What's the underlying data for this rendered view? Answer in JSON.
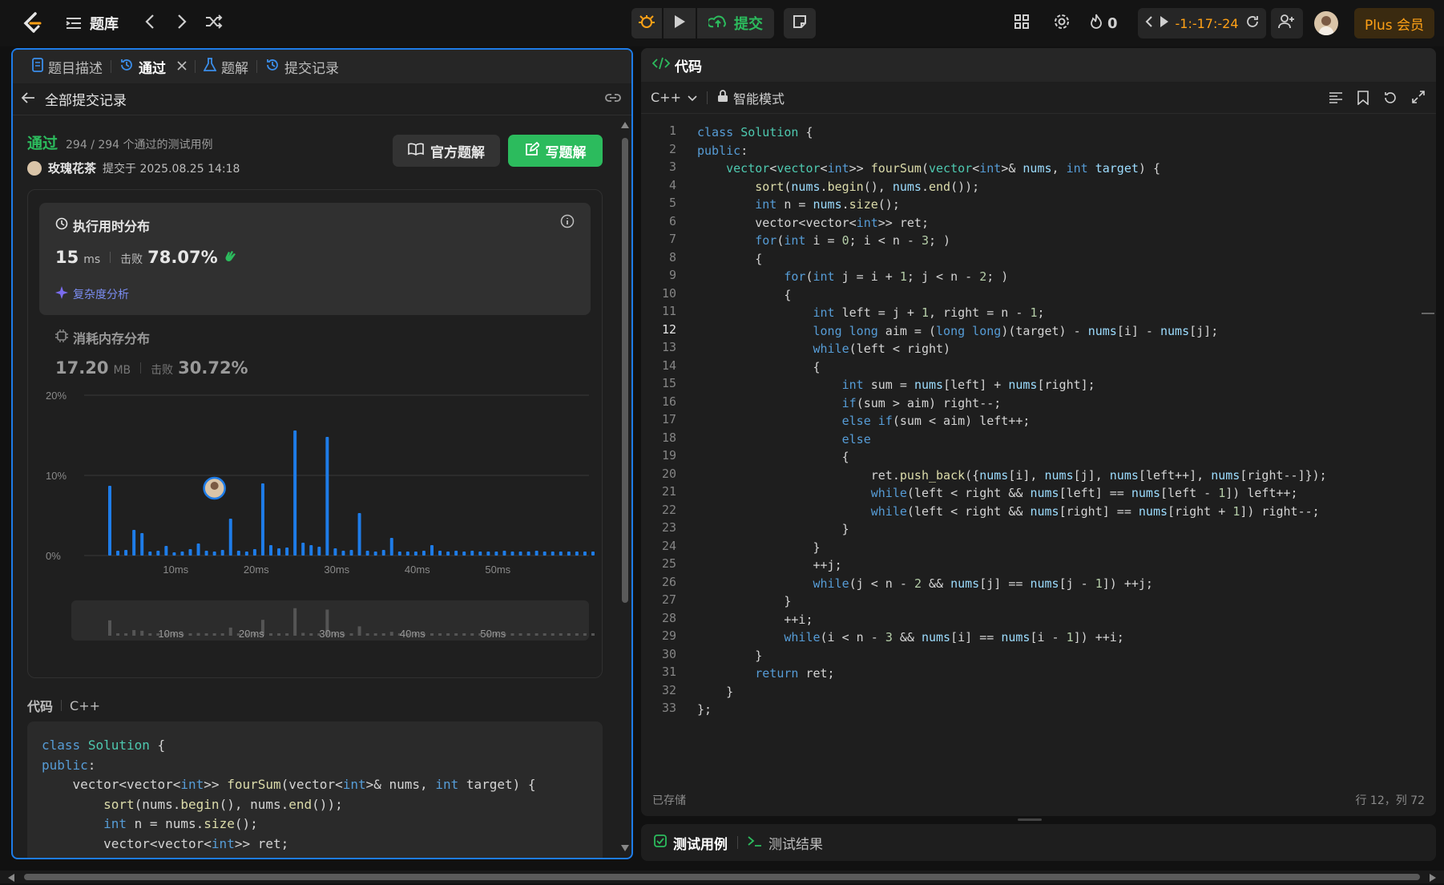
{
  "topbar": {
    "problem_list": "题库",
    "submit": "提交",
    "streak": "0",
    "timer": "-1:-17:-24",
    "plus": "Plus 会员"
  },
  "left": {
    "tabs": [
      "题目描述",
      "通过",
      "题解",
      "提交记录"
    ],
    "back_label": "全部提交记录",
    "status": "通过",
    "cases": "294 / 294 个通过的测试用例",
    "user": "玫瑰花茶",
    "submitted_at": "提交于 2025.08.25 14:18",
    "btn_official": "官方题解",
    "btn_write": "写题解",
    "runtime_title": "执行用时分布",
    "runtime_value": "15",
    "runtime_unit": "ms",
    "beat_label": "击败",
    "runtime_beat": "78.07%",
    "complexity": "复杂度分析",
    "memory_title": "消耗内存分布",
    "memory_value": "17.20",
    "memory_unit": "MB",
    "memory_beat": "30.72%",
    "code_label": "代码",
    "code_lang": "C++"
  },
  "chart_data": {
    "type": "bar",
    "title": "执行用时分布",
    "ylim": [
      0,
      20
    ],
    "yticks": [
      "20%",
      "10%",
      "0%"
    ],
    "xticks": [
      "10ms",
      "20ms",
      "30ms",
      "40ms",
      "50ms"
    ],
    "xrange_ms": [
      2,
      59
    ],
    "highlight_ms": 15,
    "values": [
      8.7,
      0.6,
      0.7,
      3.2,
      2.8,
      0.5,
      0.6,
      1.2,
      0.4,
      0.5,
      0.8,
      1.5,
      0.6,
      0.5,
      0.7,
      4.6,
      0.6,
      0.5,
      0.8,
      9.0,
      1.3,
      0.9,
      1.0,
      15.6,
      1.6,
      1.3,
      1.1,
      14.8,
      0.9,
      0.6,
      0.7,
      5.3,
      0.6,
      0.5,
      0.7,
      2.2,
      0.5,
      0.5,
      0.5,
      0.6,
      1.3,
      0.6,
      0.5,
      0.6,
      0.5,
      0.6,
      0.5,
      0.5,
      0.5,
      0.6,
      0.5,
      0.5,
      0.5,
      0.6,
      0.5,
      0.5,
      0.5,
      0.5,
      0.5,
      0.5,
      0.5
    ]
  },
  "right": {
    "title": "代码",
    "lang": "C++",
    "mode": "智能模式",
    "saved": "已存储",
    "cursor": "行 12，列 72",
    "test_case": "测试用例",
    "test_result": "测试结果"
  },
  "colors": {
    "accent": "#1e7ce8",
    "success": "#2cbb5d",
    "bar": "#1e7ce8",
    "plus": "#ffa116"
  }
}
